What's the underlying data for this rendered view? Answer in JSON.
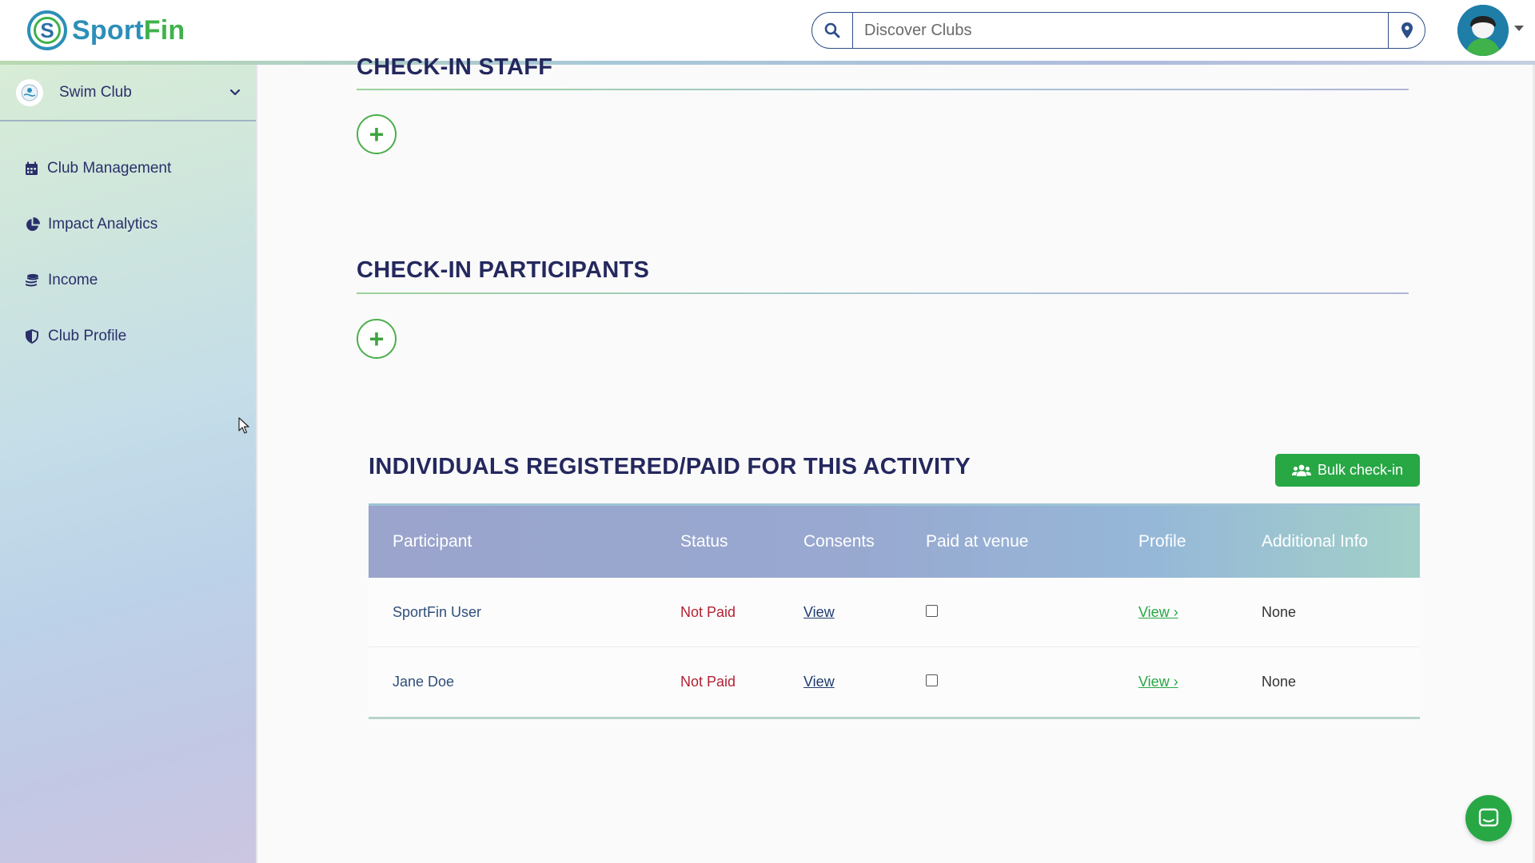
{
  "brand": {
    "name_part1": "Sport",
    "name_part2": "Fin",
    "mark_letter": "S"
  },
  "search": {
    "placeholder": "Discover Clubs",
    "value": ""
  },
  "sidebar": {
    "club_name": "Swim Club",
    "items": [
      {
        "label": "Club Management",
        "icon": "calendar-icon"
      },
      {
        "label": "Impact Analytics",
        "icon": "pie-chart-icon"
      },
      {
        "label": "Income",
        "icon": "coins-icon"
      },
      {
        "label": "Club Profile",
        "icon": "shield-icon"
      }
    ]
  },
  "main": {
    "staff_title": "CHECK-IN STAFF",
    "participants_title": "CHECK-IN PARTICIPANTS",
    "registered_title": "INDIVIDUALS REGISTERED/PAID FOR THIS ACTIVITY",
    "bulk_button": "Bulk check-in"
  },
  "table": {
    "headers": {
      "participant": "Participant",
      "status": "Status",
      "consents": "Consents",
      "paid": "Paid at venue",
      "profile": "Profile",
      "info": "Additional Info"
    },
    "rows": [
      {
        "participant": "SportFin User",
        "status": "Not Paid",
        "consents": "View",
        "paid": false,
        "profile": "View ›",
        "info": "None"
      },
      {
        "participant": "Jane Doe",
        "status": "Not Paid",
        "consents": "View",
        "paid": false,
        "profile": "View ›",
        "info": "None"
      }
    ]
  },
  "colors": {
    "brand_blue": "#2c8fb8",
    "brand_green": "#3fb24a",
    "heading_navy": "#24285e",
    "status_red": "#b22234",
    "action_green": "#28a745"
  }
}
